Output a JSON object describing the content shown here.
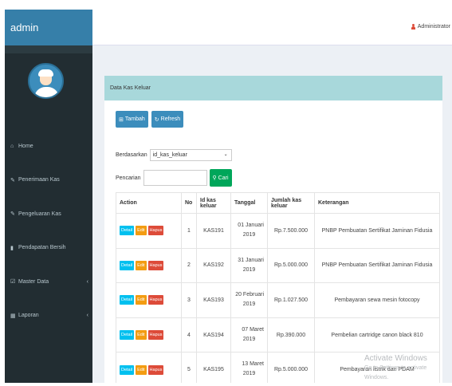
{
  "app": {
    "brand": "admin",
    "user": "Administrator"
  },
  "sidebar": {
    "items": [
      {
        "icon": "home-icon",
        "glyph": "⌂",
        "label": "Home",
        "chevron": ""
      },
      {
        "icon": "pencil-icon",
        "glyph": "✎",
        "label": "Penerimaan Kas",
        "chevron": ""
      },
      {
        "icon": "pencil-icon",
        "glyph": "✎",
        "label": "Pengeluaran Kas",
        "chevron": ""
      },
      {
        "icon": "file-icon",
        "glyph": "▮",
        "label": "Pendapatan Bersih",
        "chevron": ""
      },
      {
        "icon": "edit-icon",
        "glyph": "☑",
        "label": "Master Data",
        "chevron": "‹"
      },
      {
        "icon": "calendar-icon",
        "glyph": "▦",
        "label": "Laporan",
        "chevron": "‹"
      }
    ]
  },
  "panel": {
    "title": "Data Kas Keluar",
    "add_label": "Tambah",
    "refresh_label": "Refresh",
    "filter_label": "Berdasarkan",
    "filter_value": "id_kas_keluar",
    "search_label": "Pencarian",
    "search_button": "Cari"
  },
  "table": {
    "headers": [
      "Action",
      "No",
      "Id kas keluar",
      "Tanggal",
      "Jumlah kas keluar",
      "Keterangan"
    ],
    "actions": {
      "detail": "Detail",
      "edit": "Edit",
      "delete": "Hapus"
    },
    "rows": [
      {
        "no": "1",
        "id": "KAS191",
        "date1": "01 Januari",
        "date2": "2019",
        "amount": "Rp.7.500.000",
        "note": "PNBP Pembuatan Sertifikat Jaminan Fidusia"
      },
      {
        "no": "2",
        "id": "KAS192",
        "date1": "31 Januari",
        "date2": "2019",
        "amount": "Rp.5.000.000",
        "note": "PNBP Pembuatan Sertifikat Jaminan Fidusia"
      },
      {
        "no": "3",
        "id": "KAS193",
        "date1": "20 Februari",
        "date2": "2019",
        "amount": "Rp.1.027.500",
        "note": "Pembayaran sewa mesin fotocopy"
      },
      {
        "no": "4",
        "id": "KAS194",
        "date1": "07 Maret",
        "date2": "2019",
        "amount": "Rp.390.000",
        "note": "Pembelian cartridge canon black 810"
      },
      {
        "no": "5",
        "id": "KAS195",
        "date1": "13 Maret",
        "date2": "2019",
        "amount": "Rp.5.000.000",
        "note": "Pembayaran listrik dan PDAM"
      }
    ]
  },
  "watermark": {
    "line1": "Activate Windows",
    "line2": "Go to Settings to activate Windows."
  }
}
